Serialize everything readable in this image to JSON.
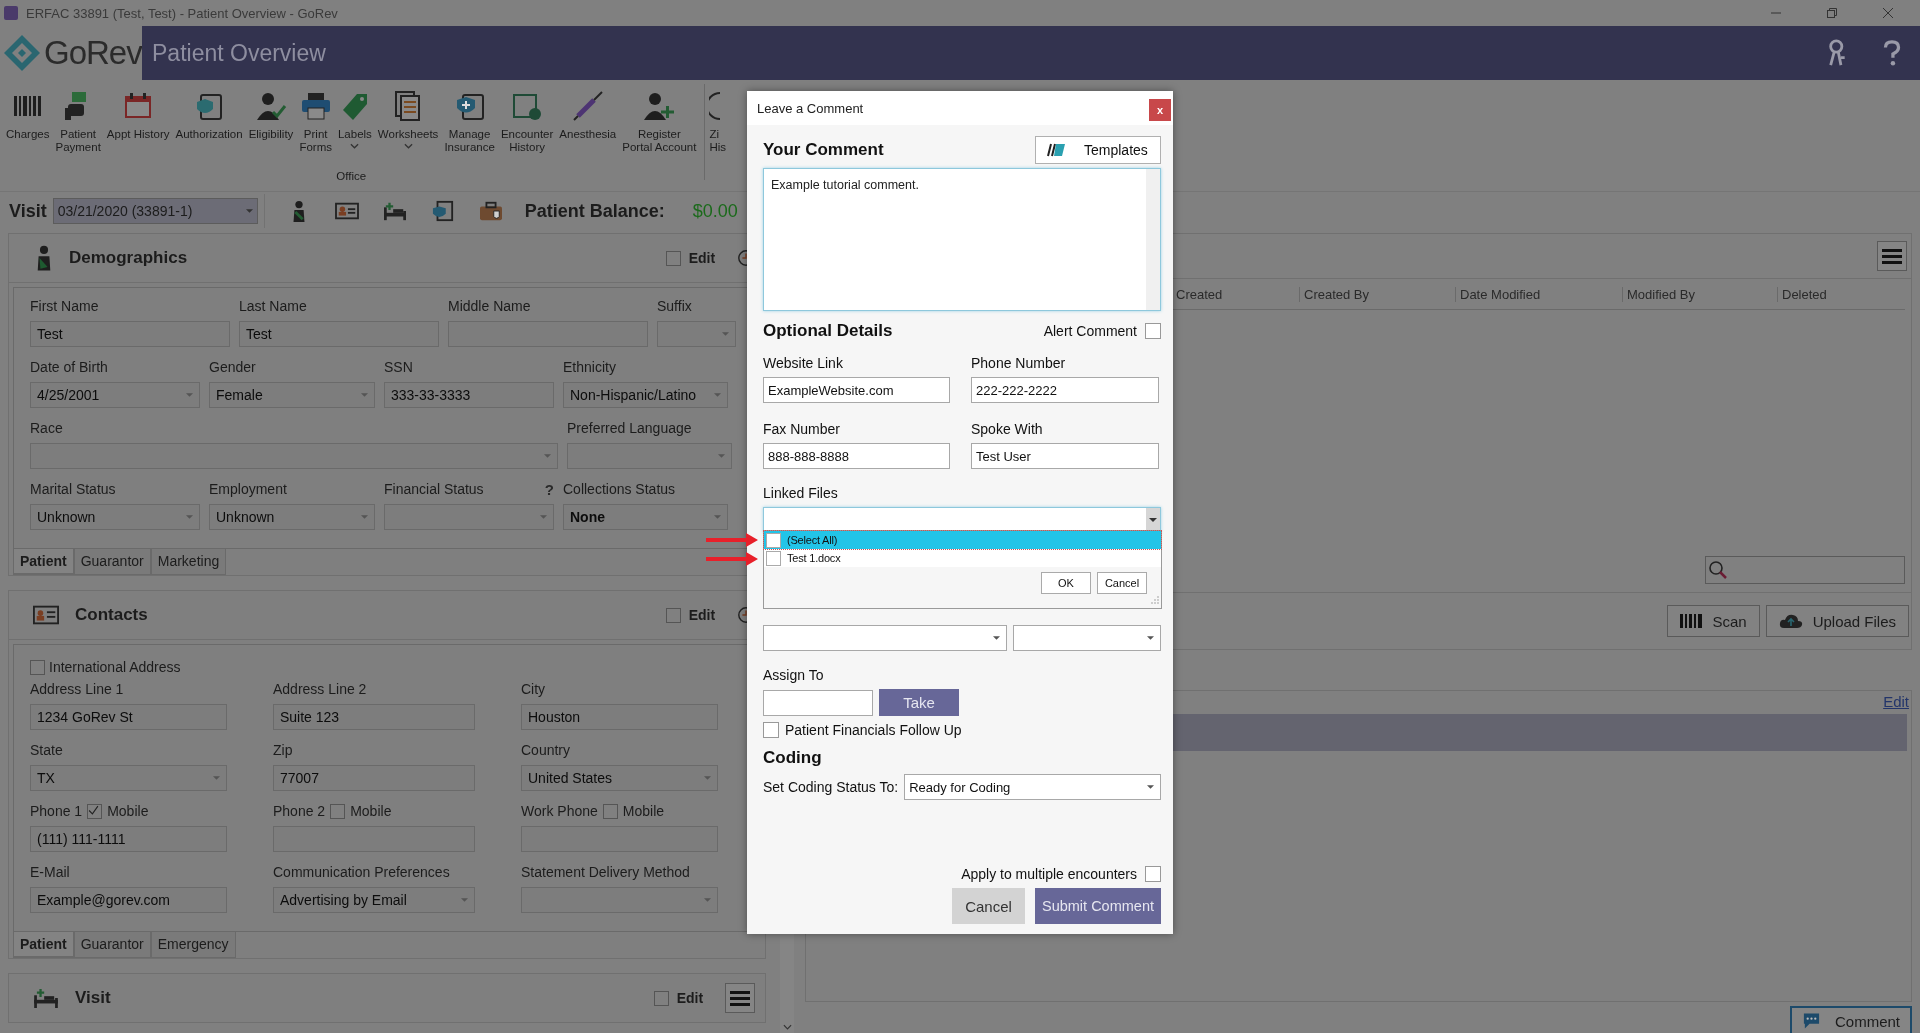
{
  "window": {
    "title": "ERFAC 33891 (Test, Test) - Patient Overview - GoRev"
  },
  "header": {
    "logo": "GoRev",
    "page_title": "Patient Overview"
  },
  "toolbar": {
    "group_label": "Office",
    "items": [
      {
        "lines": [
          "Charges"
        ],
        "dropdown": false
      },
      {
        "lines": [
          "Patient",
          "Payment"
        ],
        "dropdown": false
      },
      {
        "lines": [
          "Appt History"
        ],
        "dropdown": false
      },
      {
        "lines": [
          "Authorization"
        ],
        "dropdown": false
      },
      {
        "lines": [
          "Eligibility"
        ],
        "dropdown": false
      },
      {
        "lines": [
          "Print",
          "Forms"
        ],
        "dropdown": false
      },
      {
        "lines": [
          "Labels"
        ],
        "dropdown": true
      },
      {
        "lines": [
          "Worksheets"
        ],
        "dropdown": true
      },
      {
        "lines": [
          "Manage",
          "Insurance"
        ],
        "dropdown": false
      },
      {
        "lines": [
          "Encounter",
          "History"
        ],
        "dropdown": false
      },
      {
        "lines": [
          "Anesthesia"
        ],
        "dropdown": false
      },
      {
        "lines": [
          "Register",
          "Portal Account"
        ],
        "dropdown": false
      }
    ],
    "extra_item": {
      "lines": [
        "Zi",
        "His"
      ]
    }
  },
  "visit_bar": {
    "label": "Visit",
    "visit": "03/21/2020 (33891-1)",
    "balance_label": "Patient Balance:",
    "balance": "$0.00"
  },
  "demographics": {
    "title": "Demographics",
    "edit": {
      "label": "Edit",
      "checked": false
    },
    "fields": [
      {
        "label": "First Name",
        "kind": "text",
        "value": "Test"
      },
      {
        "label": "Last Name",
        "kind": "text",
        "value": "Test"
      },
      {
        "label": "Middle Name",
        "kind": "text"
      },
      {
        "label": "Suffix",
        "kind": "select"
      },
      {
        "label": "Date of Birth",
        "kind": "select",
        "value": "4/25/2001"
      },
      {
        "label": "Gender",
        "kind": "select",
        "value": "Female"
      },
      {
        "label": "SSN",
        "kind": "text",
        "value": "333-33-3333"
      },
      {
        "label": "Ethnicity",
        "kind": "select",
        "value": "Non-Hispanic/Latino"
      },
      {
        "label": "Race",
        "kind": "select"
      },
      {
        "label": "Preferred Language",
        "kind": "select"
      },
      {
        "label": "Marital Status",
        "kind": "select",
        "value": "Unknown"
      },
      {
        "label": "Employment",
        "kind": "select",
        "value": "Unknown"
      },
      {
        "label": "Financial Status",
        "kind": "select",
        "help": "?"
      },
      {
        "label": "Collections Status",
        "kind": "select",
        "value": "None",
        "bold": true
      }
    ],
    "tabs": [
      {
        "label": "Patient",
        "selected": true
      },
      {
        "label": "Guarantor",
        "selected": false
      },
      {
        "label": "Marketing",
        "selected": false
      }
    ]
  },
  "contacts": {
    "title": "Contacts",
    "edit": {
      "label": "Edit",
      "checked": false
    },
    "international": {
      "label": "International Address",
      "checked": false
    },
    "rows": [
      [
        {
          "label": "Address Line 1",
          "kind": "text",
          "value": "1234 GoRev St"
        },
        {
          "label": "Address Line 2",
          "kind": "text",
          "value": "Suite 123"
        },
        {
          "label": "City",
          "kind": "text",
          "value": "Houston"
        }
      ],
      [
        {
          "label": "State",
          "kind": "select",
          "value": "TX"
        },
        {
          "label": "Zip",
          "kind": "text",
          "value": "77007"
        },
        {
          "label": "Country",
          "kind": "select",
          "value": "United States"
        }
      ],
      [
        {
          "label": "Phone 1",
          "kind": "text",
          "value": "(111) 111-1111",
          "mobile": {
            "label": "Mobile",
            "checked": true
          }
        },
        {
          "label": "Phone 2",
          "kind": "text",
          "mobile": {
            "label": "Mobile",
            "checked": false
          }
        },
        {
          "label": "Work Phone",
          "kind": "text",
          "mobile": {
            "label": "Mobile",
            "checked": false
          }
        }
      ],
      [
        {
          "label": "E-Mail",
          "kind": "text",
          "value": "Example@gorev.com"
        },
        {
          "label": "Communication Preferences",
          "kind": "select",
          "value": "Advertising by Email"
        },
        {
          "label": "Statement Delivery Method",
          "kind": "select"
        }
      ]
    ],
    "tabs": [
      {
        "label": "Patient",
        "selected": true
      },
      {
        "label": "Guarantor",
        "selected": false
      },
      {
        "label": "Emergency",
        "selected": false
      }
    ]
  },
  "visit_section": {
    "title": "Visit",
    "edit": {
      "label": "Edit",
      "checked": false
    }
  },
  "files": {
    "columns": [
      "Created",
      "Created By",
      "Date Modified",
      "Modified By",
      "Deleted"
    ],
    "scan_button": "Scan",
    "upload_button": "Upload Files"
  },
  "notes": {
    "edit_link": "Edit",
    "comment_button": "Comment"
  },
  "dialog": {
    "title": "Leave a Comment",
    "close": "x",
    "comment_heading": "Your Comment",
    "templates_button": "Templates",
    "comment": "Example tutorial comment.",
    "optional_heading": "Optional Details",
    "alert": {
      "label": "Alert Comment",
      "checked": false
    },
    "fields": [
      {
        "label": "Website Link",
        "value": "ExampleWebsite.com"
      },
      {
        "label": "Phone Number",
        "value": "222-222-2222"
      },
      {
        "label": "Fax Number",
        "value": "888-888-8888"
      },
      {
        "label": "Spoke With",
        "value": "Test User"
      }
    ],
    "linked_files": {
      "label": "Linked Files",
      "expanded": true,
      "ok": "OK",
      "cancel": "Cancel",
      "options": [
        {
          "label": "(Select All)",
          "checked": false,
          "selected": true
        },
        {
          "label": "Test 1.docx",
          "checked": false,
          "selected": false
        }
      ]
    },
    "assign": {
      "label": "Assign To",
      "button": "Take"
    },
    "financials": {
      "label": "Patient Financials Follow Up",
      "checked": false
    },
    "coding_heading": "Coding",
    "coding": {
      "label": "Set Coding Status To:",
      "value": "Ready for Coding"
    },
    "multiple": {
      "label": "Apply to multiple encounters",
      "checked": false
    },
    "buttons": {
      "cancel": "Cancel",
      "submit": "Submit Comment"
    }
  }
}
